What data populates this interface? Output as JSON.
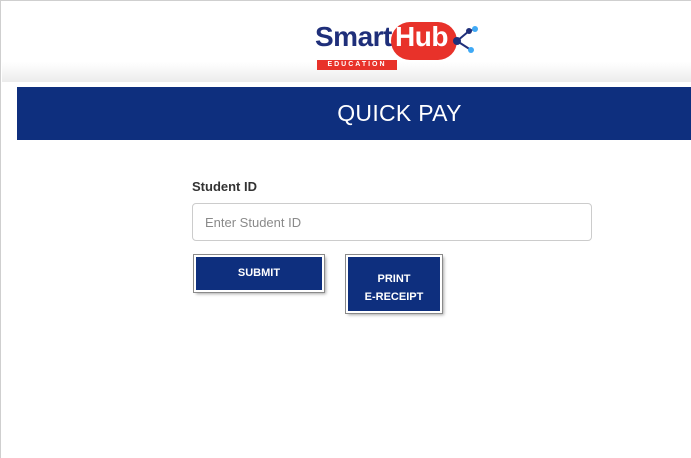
{
  "logo": {
    "brand_smart": "Smart",
    "brand_hub": "Hub",
    "tagline": "EDUCATION"
  },
  "header": {
    "title": "QUICK PAY"
  },
  "form": {
    "student_id_label": "Student ID",
    "student_id_placeholder": "Enter Student ID",
    "student_id_value": "",
    "submit_label": "SUBMIT",
    "print_label_line1": "PRINT",
    "print_label_line2": "E-RECEIPT"
  },
  "colors": {
    "brand_navy": "#0e2f7e",
    "brand_red": "#e8322a"
  }
}
